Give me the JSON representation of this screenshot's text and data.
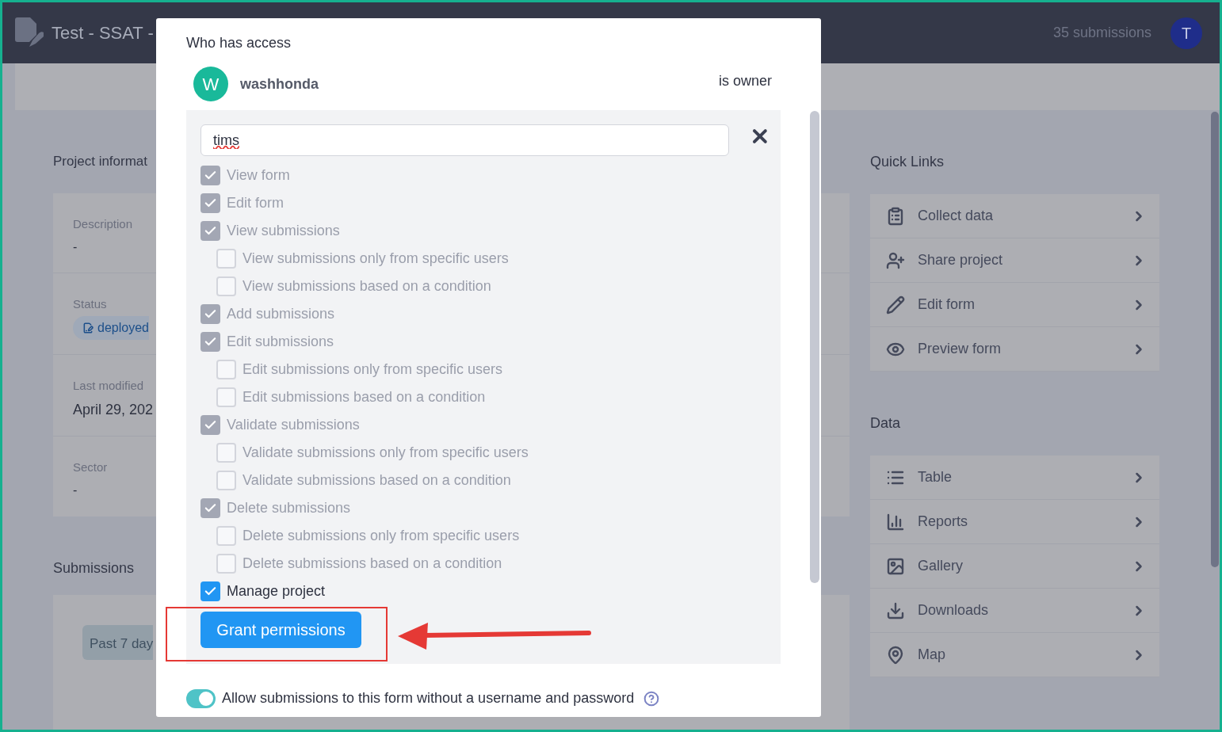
{
  "header": {
    "title": "Test - SSAT -",
    "submission_count": "35 submissions",
    "avatar": "T"
  },
  "project_info": {
    "heading": "Project informat",
    "fields": [
      {
        "kind": "text",
        "label": "Description",
        "value": "-"
      },
      {
        "kind": "status",
        "label": "Status",
        "value": "deployed"
      },
      {
        "kind": "date",
        "label": "Last modified",
        "value": "April 29, 202"
      },
      {
        "kind": "text",
        "label": "Sector",
        "value": "-"
      }
    ]
  },
  "submissions": {
    "heading": "Submissions",
    "period_button": "Past 7 day"
  },
  "quick_links": {
    "heading": "Quick Links",
    "items": [
      {
        "label": "Collect data"
      },
      {
        "label": "Share project"
      },
      {
        "label": "Edit form"
      },
      {
        "label": "Preview form"
      }
    ]
  },
  "data_links": {
    "heading": "Data",
    "items": [
      {
        "label": "Table"
      },
      {
        "label": "Reports"
      },
      {
        "label": "Gallery"
      },
      {
        "label": "Downloads"
      },
      {
        "label": "Map"
      }
    ]
  },
  "modal": {
    "title": "Who has access",
    "owner": {
      "initial": "W",
      "username": "washhonda",
      "role": "is owner"
    },
    "user_field": {
      "value": "tims"
    },
    "permissions": [
      {
        "label": "View form",
        "checked": true,
        "disabled": true
      },
      {
        "label": "Edit form",
        "checked": true,
        "disabled": true
      },
      {
        "label": "View submissions",
        "checked": true,
        "disabled": true,
        "children": [
          {
            "label": "View submissions only from specific users",
            "checked": false,
            "disabled": true
          },
          {
            "label": "View submissions based on a condition",
            "checked": false,
            "disabled": true
          }
        ]
      },
      {
        "label": "Add submissions",
        "checked": true,
        "disabled": true
      },
      {
        "label": "Edit submissions",
        "checked": true,
        "disabled": true,
        "children": [
          {
            "label": "Edit submissions only from specific users",
            "checked": false,
            "disabled": true
          },
          {
            "label": "Edit submissions based on a condition",
            "checked": false,
            "disabled": true
          }
        ]
      },
      {
        "label": "Validate submissions",
        "checked": true,
        "disabled": true,
        "children": [
          {
            "label": "Validate submissions only from specific users",
            "checked": false,
            "disabled": true
          },
          {
            "label": "Validate submissions based on a condition",
            "checked": false,
            "disabled": true
          }
        ]
      },
      {
        "label": "Delete submissions",
        "checked": true,
        "disabled": true,
        "children": [
          {
            "label": "Delete submissions only from specific users",
            "checked": false,
            "disabled": true
          },
          {
            "label": "Delete submissions based on a condition",
            "checked": false,
            "disabled": true
          }
        ]
      },
      {
        "label": "Manage project",
        "checked": true,
        "disabled": false
      }
    ],
    "grant_button": "Grant permissions",
    "anonymous_toggle": {
      "label": "Allow submissions to this form without a username and password",
      "on": true
    }
  }
}
